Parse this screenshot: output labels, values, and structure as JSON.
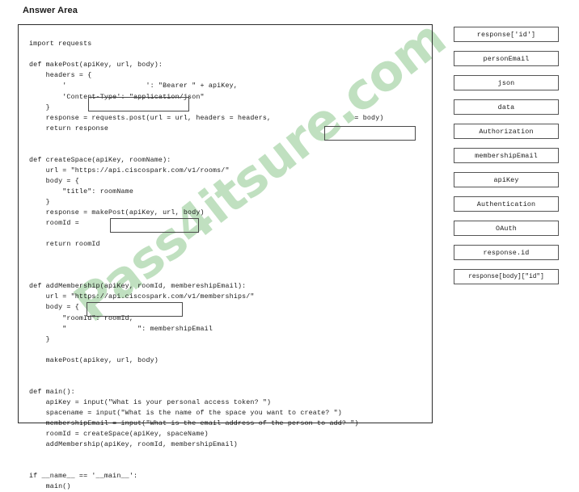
{
  "page": {
    "answer_area_label": "Answer Area",
    "watermark": "Pass4itsure.com",
    "watermark_color": "#a9d5a9",
    "border_color": "#2b2b2b",
    "blank_border_color": "#4a4a4a"
  },
  "code": {
    "language": "python",
    "text": "import requests\n\ndef makePost(apiKey, url, body):\n    headers = {\n        '                   ': \"Bearer \" + apiKey,\n        'Content-Type': \"application/json\"\n    }\n    response = requests.post(url = url, headers = headers,                    = body)\n    return response\n\n\ndef createSpace(apiKey, roomName):\n    url = \"https://api.ciscospark.com/v1/rooms/\"\n    body = {\n        \"title\": roomName\n    }\n    response = makePost(apiKey, url, body)\n    roomId =\n\n    return roomId\n\n\n\ndef addMembership(apiKey, roomId, membereshipEmail):\n    url = \"https://api.ciscospark.com/v1/memberships/\"\n    body = {\n        \"roomId\": roomId,\n        \"                 \": membershipEmail\n    }\n\n    makePost(apikey, url, body)\n\n\ndef main():\n    apiKey = input(\"What is your personal access token? \")\n    spacename = input(\"What is the name of the space you want to create? \")\n    membershipEmail = input(\"What is the email address of the person to add? \")\n    roomId = createSpace(apiKey, spaceName)\n    addMembership(apiKey, roomId, membershipEmail)\n\n\nif __name__ == '__main__':\n    main()"
  },
  "blanks": [
    {
      "id": "blank-auth",
      "name": "header-key-blank",
      "value": ""
    },
    {
      "id": "blank-json",
      "name": "post-payload-blank",
      "value": ""
    },
    {
      "id": "blank-roomid",
      "name": "room-id-blank",
      "value": ""
    },
    {
      "id": "blank-person",
      "name": "person-email-blank",
      "value": ""
    }
  ],
  "options": [
    {
      "label": "response['id']",
      "tight": false
    },
    {
      "label": "personEmail",
      "tight": false
    },
    {
      "label": "json",
      "tight": false
    },
    {
      "label": "data",
      "tight": false
    },
    {
      "label": "Authorization",
      "tight": false
    },
    {
      "label": "membershipEmail",
      "tight": false
    },
    {
      "label": "apiKey",
      "tight": false
    },
    {
      "label": "Authentication",
      "tight": false
    },
    {
      "label": "OAuth",
      "tight": false
    },
    {
      "label": "response.id",
      "tight": false
    },
    {
      "label": "response[body][\"id\"]",
      "tight": true
    }
  ]
}
